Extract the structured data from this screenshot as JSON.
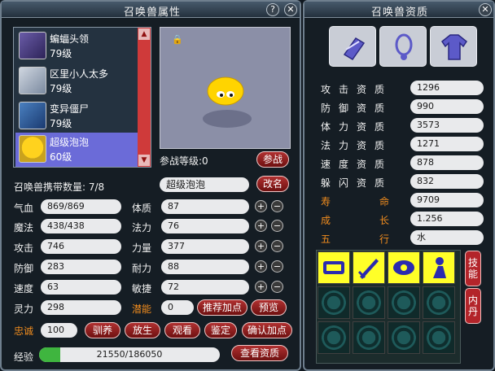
{
  "attr_window": {
    "title": "召唤兽属性",
    "help": "?",
    "close": "✕",
    "pets": [
      {
        "name": "蝙蝠头领",
        "level": "79级"
      },
      {
        "name": "区里小人太多",
        "level": "79级"
      },
      {
        "name": "变异僵尸",
        "level": "79级"
      },
      {
        "name": "超级泡泡",
        "level": "60级"
      }
    ],
    "battle_level_label": "参战等级:",
    "battle_level_value": "0",
    "battle_btn": "参战",
    "carry_label": "召唤兽携带数量:",
    "carry_value": "7/8",
    "current_name": "超级泡泡",
    "rename_btn": "改名",
    "stats_left": [
      {
        "label": "气血",
        "value": "869/869"
      },
      {
        "label": "魔法",
        "value": "438/438"
      },
      {
        "label": "攻击",
        "value": "746"
      },
      {
        "label": "防御",
        "value": "283"
      },
      {
        "label": "速度",
        "value": "63"
      },
      {
        "label": "灵力",
        "value": "298"
      }
    ],
    "stats_right": [
      {
        "label": "体质",
        "value": "87"
      },
      {
        "label": "法力",
        "value": "76"
      },
      {
        "label": "力量",
        "value": "377"
      },
      {
        "label": "耐力",
        "value": "88"
      },
      {
        "label": "敏捷",
        "value": "72"
      }
    ],
    "potential_label": "潜能",
    "potential_value": "0",
    "recommend_btn": "推荐加点",
    "preview_btn": "预览",
    "loyalty_label": "忠诚",
    "loyalty_value": "100",
    "btn_tame": "驯养",
    "btn_release": "放生",
    "btn_view": "观看",
    "btn_appraise": "鉴定",
    "btn_confirm": "确认加点",
    "exp_label": "经验",
    "exp_value": "21550/186050",
    "exp_fraction": 0.116,
    "view_qual_btn": "查看资质",
    "plus": "+",
    "minus": "−"
  },
  "qual_window": {
    "title": "召唤兽资质",
    "close": "✕",
    "quals": [
      {
        "label": "攻击资质",
        "value": "1296",
        "orange": false
      },
      {
        "label": "防御资质",
        "value": "990",
        "orange": false
      },
      {
        "label": "体力资质",
        "value": "3573",
        "orange": false
      },
      {
        "label": "法力资质",
        "value": "1271",
        "orange": false
      },
      {
        "label": "速度资质",
        "value": "878",
        "orange": false
      },
      {
        "label": "躲闪资质",
        "value": "832",
        "orange": false
      }
    ],
    "lifespan_label": [
      "寿",
      "命"
    ],
    "lifespan_value": "9709",
    "growth_label": [
      "成",
      "长"
    ],
    "growth_value": "1.256",
    "element_label": [
      "五",
      "行"
    ],
    "element_value": "水",
    "skill_btn": "技能",
    "dan_btn": "内丹"
  },
  "colors": {
    "accent": "#b03030",
    "panel": "#151d24",
    "highlight": "#f08c1e",
    "skill_slot": "#ffff28"
  }
}
